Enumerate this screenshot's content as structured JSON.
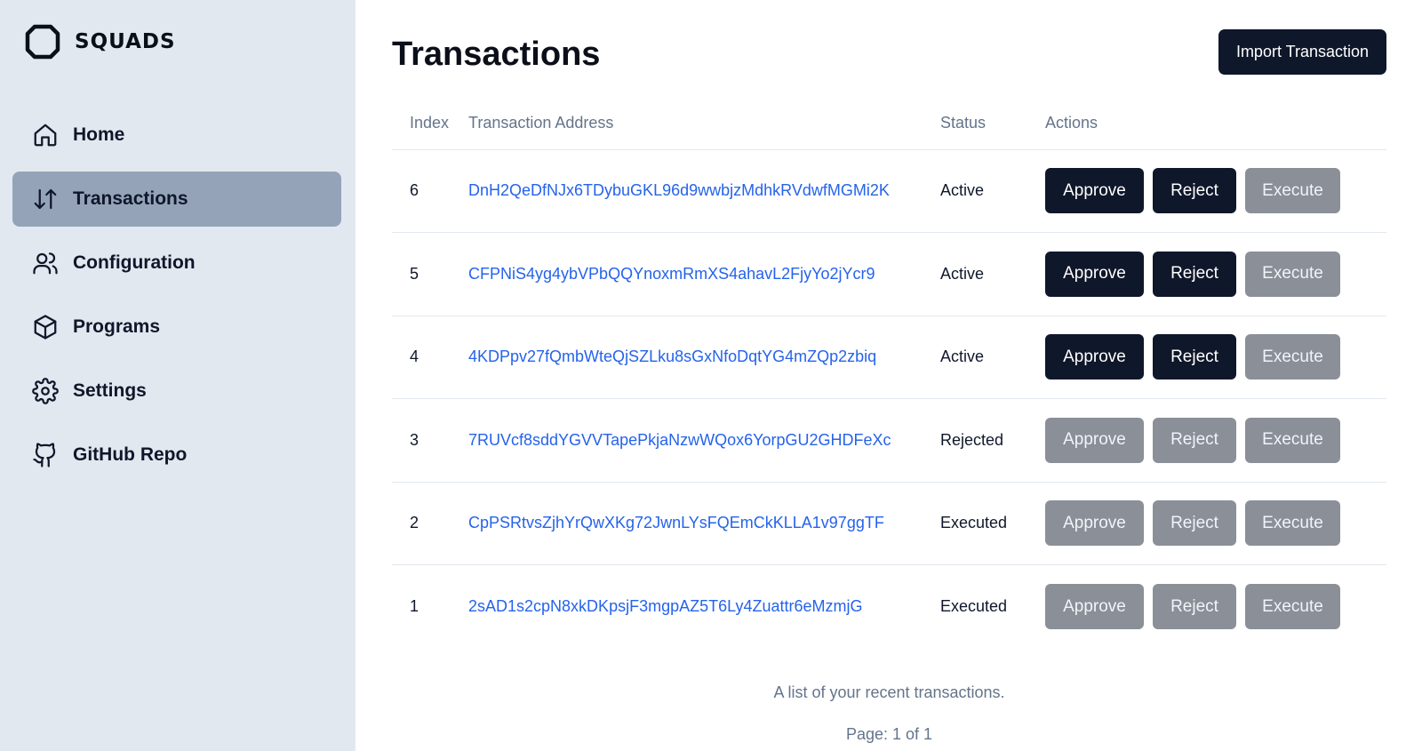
{
  "brand": {
    "name": "SQUADS"
  },
  "sidebar": {
    "items": [
      {
        "label": "Home",
        "icon": "home-icon",
        "active": false
      },
      {
        "label": "Transactions",
        "icon": "arrows-up-down-icon",
        "active": true
      },
      {
        "label": "Configuration",
        "icon": "users-icon",
        "active": false
      },
      {
        "label": "Programs",
        "icon": "box-icon",
        "active": false
      },
      {
        "label": "Settings",
        "icon": "gear-icon",
        "active": false
      },
      {
        "label": "GitHub Repo",
        "icon": "github-icon",
        "active": false
      }
    ]
  },
  "header": {
    "title": "Transactions",
    "import_label": "Import Transaction"
  },
  "table": {
    "columns": [
      "Index",
      "Transaction Address",
      "Status",
      "Actions"
    ],
    "rows": [
      {
        "index": "6",
        "address": "DnH2QeDfNJx6TDybuGKL96d9wwbjzMdhkRVdwfMGMi2K",
        "status": "Active",
        "approve": "Approve",
        "reject": "Reject",
        "execute": "Execute",
        "approve_enabled": true,
        "reject_enabled": true,
        "execute_enabled": false
      },
      {
        "index": "5",
        "address": "CFPNiS4yg4ybVPbQQYnoxmRmXS4ahavL2FjyYo2jYcr9",
        "status": "Active",
        "approve": "Approve",
        "reject": "Reject",
        "execute": "Execute",
        "approve_enabled": true,
        "reject_enabled": true,
        "execute_enabled": false
      },
      {
        "index": "4",
        "address": "4KDPpv27fQmbWteQjSZLku8sGxNfoDqtYG4mZQp2zbiq",
        "status": "Active",
        "approve": "Approve",
        "reject": "Reject",
        "execute": "Execute",
        "approve_enabled": true,
        "reject_enabled": true,
        "execute_enabled": false
      },
      {
        "index": "3",
        "address": "7RUVcf8sddYGVVTapePkjaNzwWQox6YorpGU2GHDFeXc",
        "status": "Rejected",
        "approve": "Approve",
        "reject": "Reject",
        "execute": "Execute",
        "approve_enabled": false,
        "reject_enabled": false,
        "execute_enabled": false
      },
      {
        "index": "2",
        "address": "CpPSRtvsZjhYrQwXKg72JwnLYsFQEmCkKLLA1v97ggTF",
        "status": "Executed",
        "approve": "Approve",
        "reject": "Reject",
        "execute": "Execute",
        "approve_enabled": false,
        "reject_enabled": false,
        "execute_enabled": false
      },
      {
        "index": "1",
        "address": "2sAD1s2cpN8xkDKpsjF3mgpAZ5T6Ly4Zuattr6eMzmjG",
        "status": "Executed",
        "approve": "Approve",
        "reject": "Reject",
        "execute": "Execute",
        "approve_enabled": false,
        "reject_enabled": false,
        "execute_enabled": false
      }
    ],
    "caption": "A list of your recent transactions."
  },
  "pagination": {
    "text": "Page: 1 of 1"
  },
  "colors": {
    "sidebar_bg": "#e2e8f0",
    "active_item": "#94a3b8",
    "primary_button": "#0f172a",
    "disabled_button": "#8a8f98",
    "link": "#2563eb"
  }
}
